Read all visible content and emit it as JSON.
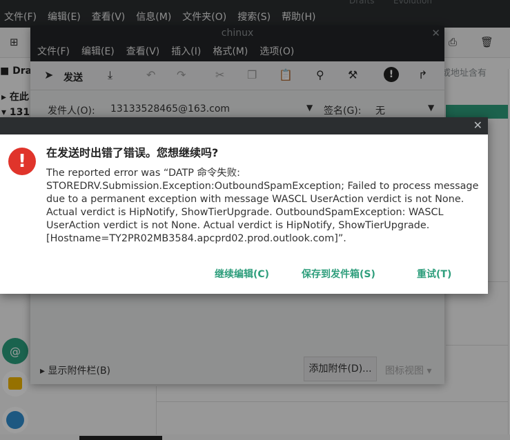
{
  "background_window": {
    "title_faint_1": "Drafts",
    "title_faint_2": "Evolution",
    "menu": [
      "文件(F)",
      "编辑(E)",
      "查看(V)",
      "信息(M)",
      "文件夹(O)",
      "搜索(S)",
      "帮助(H)"
    ],
    "sidebar_label": "Dra",
    "tree_item_1": "在此",
    "tree_item_2": "131",
    "hint_text": "或地址含有"
  },
  "composer": {
    "title": "chinux",
    "menu": [
      "文件(F)",
      "编辑(E)",
      "查看(V)",
      "插入(I)",
      "格式(M)",
      "选项(O)"
    ],
    "send_label": "发送",
    "from_label": "发件人(O):",
    "from_value": "13133528465@163.com",
    "signature_label": "签名(G):",
    "signature_value": "无",
    "attachment_bar_label": "显示附件栏(B)",
    "add_attachment_label": "添加附件(D)...",
    "icon_view_label": "图标视图"
  },
  "error_dialog": {
    "title": "在发送时出错了错误。您想继续吗?",
    "message": "The reported error was “DATP 命令失败: STOREDRV.Submission.Exception:OutboundSpamException; Failed to process message due to a permanent exception with message WASCL UserAction verdict is not None. Actual verdict is HipNotify, ShowTierUpgrade. OutboundSpamException: WASCL UserAction verdict is not None. Actual verdict is HipNotify, ShowTierUpgrade. [Hostname=TY2PR02MB3584.apcprd02.prod.outlook.com]”.",
    "buttons": {
      "continue_editing": "继续编辑(C)",
      "save_to_outbox": "保存到发件箱(S)",
      "retry": "重试(T)"
    }
  },
  "colors": {
    "accent": "#2e9e7c",
    "error": "#e0342b",
    "titlebar": "#2b2e30"
  }
}
